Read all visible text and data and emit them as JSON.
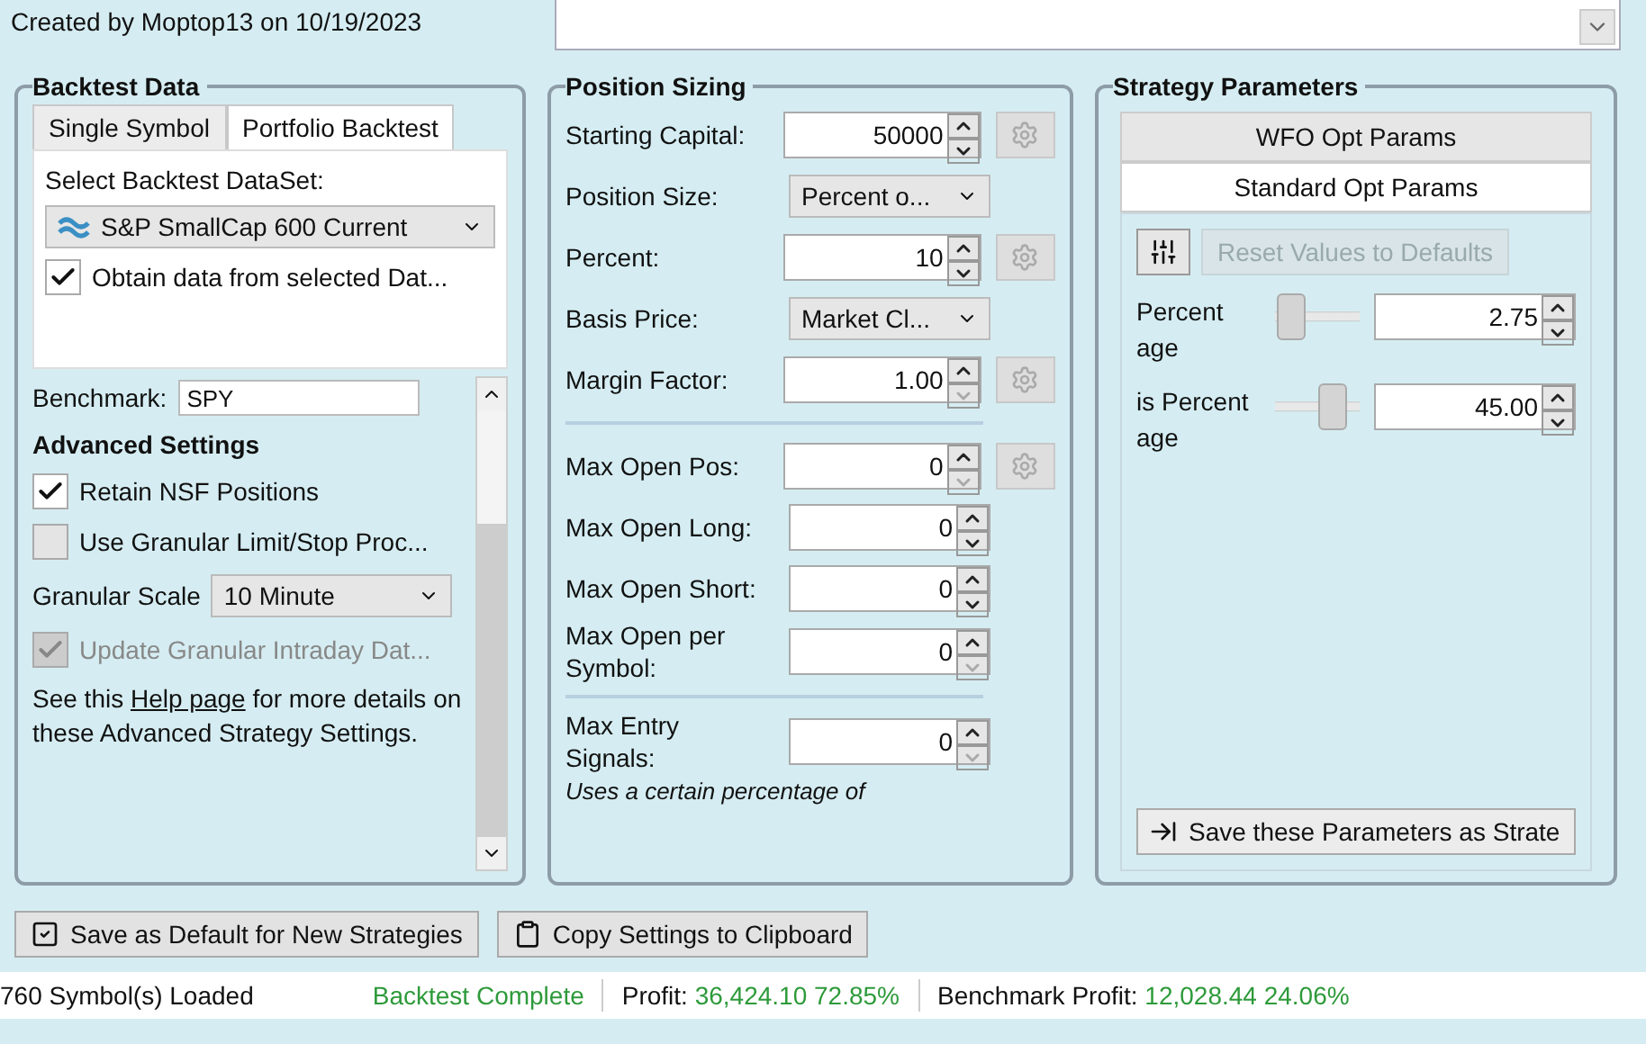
{
  "header": {
    "created": "Created by Moptop13 on 10/19/2023"
  },
  "backtest_data": {
    "title": "Backtest Data",
    "tabs": [
      {
        "label": "Single Symbol",
        "selected": false
      },
      {
        "label": "Portfolio Backtest",
        "selected": true
      }
    ],
    "dataset_label": "Select Backtest DataSet:",
    "dataset_value": "S&P SmallCap 600 Current",
    "obtain": {
      "label": "Obtain data from selected Dat...",
      "checked": true
    },
    "benchmark": {
      "label": "Benchmark:",
      "value": "SPY"
    },
    "advanced_title": "Advanced Settings",
    "options": [
      {
        "kind": "checkbox",
        "label": "Retain NSF Positions",
        "checked": true,
        "disabled": false
      },
      {
        "kind": "checkbox",
        "label": "Use Granular Limit/Stop Proc...",
        "checked": false,
        "disabled": false
      },
      {
        "kind": "select",
        "label": "Granular Scale",
        "value": "10 Minute"
      },
      {
        "kind": "checkbox",
        "label": "Update Granular Intraday Dat...",
        "checked": true,
        "disabled": true
      }
    ],
    "help": {
      "before": "See this ",
      "link": "Help page",
      "after": " for more details on these Advanced Strategy Settings."
    }
  },
  "position_sizing": {
    "title": "Position Sizing",
    "groups": [
      [
        {
          "kind": "spin",
          "label": "Starting Capital:",
          "value": "50000",
          "can_decrease": true,
          "gear": true
        },
        {
          "kind": "select",
          "label": "Position Size:",
          "value": "Percent o..."
        },
        {
          "kind": "spin",
          "label": "Percent:",
          "value": "10",
          "can_decrease": true,
          "gear": true
        },
        {
          "kind": "select",
          "label": "Basis Price:",
          "value": "Market Cl..."
        },
        {
          "kind": "spin",
          "label": "Margin Factor:",
          "value": "1.00",
          "can_decrease": false,
          "gear": true
        }
      ],
      [
        {
          "kind": "spin",
          "label": "Max Open Pos:",
          "value": "0",
          "can_decrease": false,
          "gear": true
        },
        {
          "kind": "spin",
          "label": "Max Open Long:",
          "value": "0",
          "can_decrease": true,
          "gear": false
        },
        {
          "kind": "spin",
          "label": "Max Open Short:",
          "value": "0",
          "can_decrease": true,
          "gear": false
        },
        {
          "kind": "spin",
          "label": "Max Open per Symbol:",
          "value": "0",
          "can_decrease": false,
          "gear": false
        }
      ],
      [
        {
          "kind": "spin",
          "label": "Max Entry Signals:",
          "value": "0",
          "can_decrease": false,
          "gear": false
        }
      ]
    ],
    "note": "Uses a certain percentage of"
  },
  "strategy_parameters": {
    "title": "Strategy Parameters",
    "tabs": [
      {
        "label": "WFO Opt Params",
        "selected": false
      },
      {
        "label": "Standard Opt Params",
        "selected": true
      }
    ],
    "reset": {
      "label": "Reset Values to Defaults",
      "disabled": true
    },
    "params": [
      {
        "label": "Percent age",
        "level": 0.05,
        "value": "2.75"
      },
      {
        "label": "is Percent age",
        "level": 0.75,
        "value": "45.00"
      }
    ],
    "save": "Save these Parameters as Strate"
  },
  "buttons": [
    {
      "kind": "save",
      "label": "Save as Default for New Strategies"
    },
    {
      "kind": "copy",
      "label": "Copy Settings to Clipboard"
    }
  ],
  "status_bar": {
    "symbols": "760 Symbol(s) Loaded",
    "state": "Backtest Complete",
    "profit_label": "Profit:",
    "profit": "36,424.10 72.85%",
    "benchmark_label": "Benchmark Profit:",
    "benchmark": "12,028.44 24.06%"
  }
}
